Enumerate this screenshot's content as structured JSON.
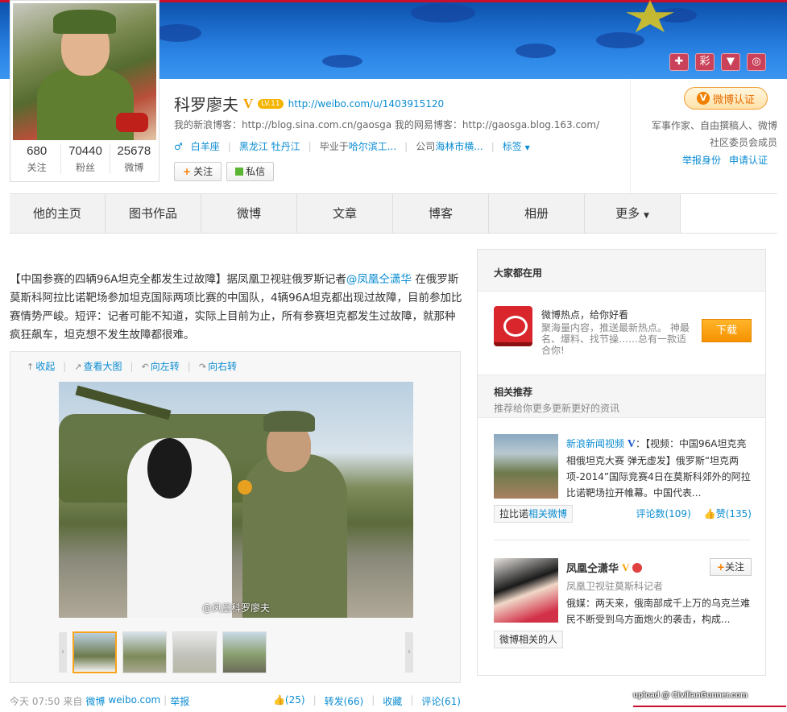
{
  "banner": {
    "icons": [
      "medical-icon",
      "color-icon",
      "badge-icon",
      "camera-icon"
    ],
    "icon_glyphs": [
      "✚",
      "彩",
      "▼",
      "◎"
    ]
  },
  "profile": {
    "name": "科罗廖夫",
    "level": "LV.11",
    "url": "http://weibo.com/u/1403915120",
    "blogs": "我的新浪博客：http://blog.sina.com.cn/gaosga 我的网易博客：http://gaosga.blog.163.com/",
    "zodiac": "白羊座",
    "location": "黑龙江  牡丹江",
    "school_prefix": "毕业于",
    "school": "哈尔滨工...",
    "company_prefix": "公司",
    "company": "海林市横...",
    "tags_label": "标签",
    "follow_btn": "关注",
    "message_btn": "私信",
    "stats": [
      {
        "num": "680",
        "label": "关注"
      },
      {
        "num": "70440",
        "label": "粉丝"
      },
      {
        "num": "25678",
        "label": "微博"
      }
    ]
  },
  "verify": {
    "button": "微博认证",
    "desc": "军事作家、自由撰稿人、微博社区委员会成员",
    "report": "举报身份",
    "apply": "申请认证"
  },
  "nav": {
    "tabs": [
      "他的主页",
      "图书作品",
      "微博",
      "文章",
      "博客",
      "相册",
      "更多"
    ]
  },
  "post": {
    "text_before": "【中国参赛的四辆96A坦克全都发生过故障】据凤凰卫视驻俄罗斯记者",
    "mention": "@凤凰仝潇华",
    "text_after": " 在俄罗斯莫斯科阿拉比诺靶场参加坦克国际两项比赛的中国队，4辆96A坦克都出现过故障，目前参加比赛情势严峻。短评：记者可能不知道，实际上目前为止，所有参赛坦克都发生过故障，就那种疯狂飙车，坦克想不发生故障都很难。",
    "tools": [
      "收起",
      "查看大图",
      "向左转",
      "向右转"
    ],
    "watermark": "@凤凰科罗廖夫",
    "time": "今天  07:50",
    "from_prefix": "来自",
    "from": "微博",
    "from_domain": "weibo.com",
    "report": "举报",
    "like": "(25)",
    "repost": "转发(66)",
    "fav": "收藏",
    "comment": "评论(61)"
  },
  "sidebar": {
    "header": "大家都在用",
    "app": {
      "title": "微博热点，给你好看",
      "desc": "聚海量内容，推送最新热点。 神最名、爆料、找节操……总有一款适合你!",
      "download": "下载"
    },
    "rec_title": "相关推荐",
    "rec_desc": "推荐给你更多更新更好的资讯",
    "rec1": {
      "name": "新浪新闻视频",
      "text": "：【视频：中国96A坦克亮相俄坦克大赛 弹无虚发】俄罗斯“坦克两项-2014”国际竞赛4日在莫斯科郊外的阿拉比诺靶场拉开帷幕。中国代表...",
      "tag_prefix": "拉比诺",
      "tag_suffix": "相关微博",
      "comments": "评论数(109)",
      "likes": "赞(135)"
    },
    "rec2": {
      "name": "凤凰仝潇华",
      "follow": "关注",
      "title": "凤凰卫视驻莫斯科记者",
      "text": "俄媒：两天来，俄南部成千上万的乌克兰难民不断受到乌方面炮火的袭击，构成...",
      "tag": "微博相关的人"
    }
  },
  "upload_credit": "upload @ CivilianGunner.com"
}
